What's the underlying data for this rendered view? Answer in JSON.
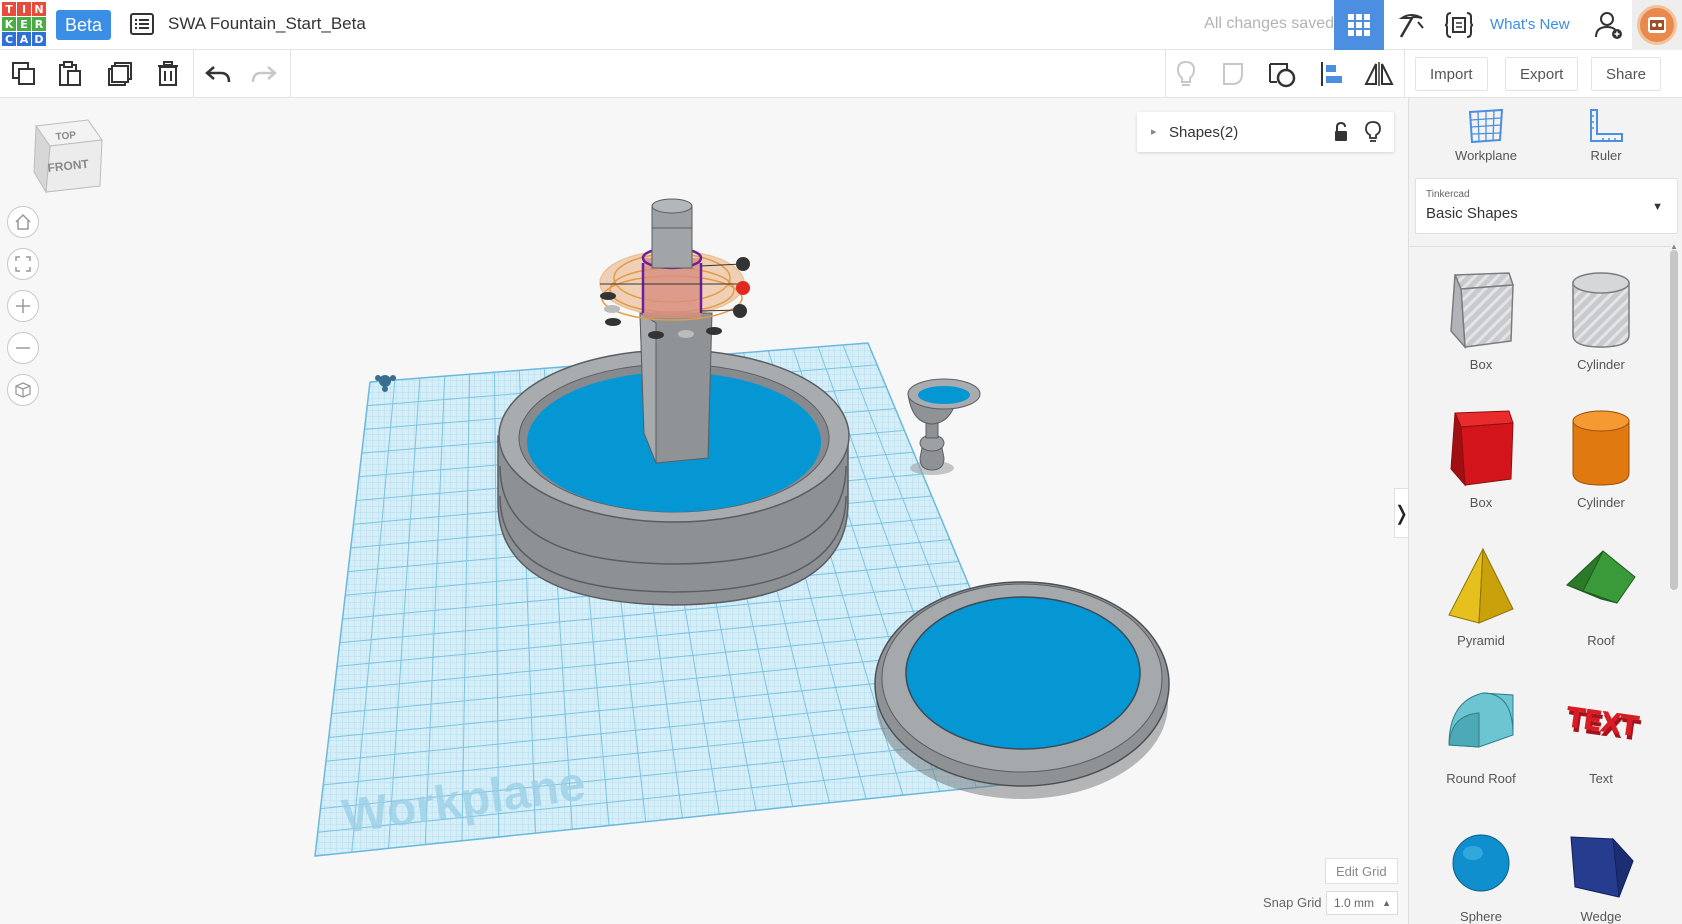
{
  "app": {
    "logo_letters": [
      "T",
      "I",
      "N",
      "K",
      "E",
      "R",
      "C",
      "A",
      "D"
    ],
    "logo_colors": [
      "#e84a3c",
      "#e84a3c",
      "#e84a3c",
      "#4bab44",
      "#4bab44",
      "#4bab44",
      "#2f6fd8",
      "#2f6fd8",
      "#2f6fd8"
    ],
    "beta_label": "Beta",
    "design_title": "SWA Fountain_Start_Beta",
    "save_status": "All changes saved",
    "whats_new": "What's New"
  },
  "toolbar": {
    "import_label": "Import",
    "export_label": "Export",
    "share_label": "Share"
  },
  "canvas": {
    "view_cube_top": "TOP",
    "view_cube_front": "FRONT",
    "workplane_watermark": "Workplane",
    "shapes_panel_label": "Shapes(2)",
    "edit_grid_label": "Edit Grid",
    "snap_grid_label": "Snap Grid",
    "snap_grid_value": "1.0 mm",
    "accent_color": "#4c8fe0",
    "water_color": "#0597d4"
  },
  "right_panel": {
    "workplane_label": "Workplane",
    "ruler_label": "Ruler",
    "library_sub": "Tinkercad",
    "library_main": "Basic Shapes",
    "shapes": [
      {
        "label": "Box",
        "icon": "box-hole-icon"
      },
      {
        "label": "Cylinder",
        "icon": "cylinder-hole-icon"
      },
      {
        "label": "Box",
        "icon": "box-red-icon"
      },
      {
        "label": "Cylinder",
        "icon": "cylinder-orange-icon"
      },
      {
        "label": "Pyramid",
        "icon": "pyramid-icon"
      },
      {
        "label": "Roof",
        "icon": "roof-icon"
      },
      {
        "label": "Round Roof",
        "icon": "round-roof-icon"
      },
      {
        "label": "Text",
        "icon": "text-shape-icon"
      },
      {
        "label": "Sphere",
        "icon": "sphere-icon"
      },
      {
        "label": "Wedge",
        "icon": "wedge-icon"
      }
    ]
  }
}
